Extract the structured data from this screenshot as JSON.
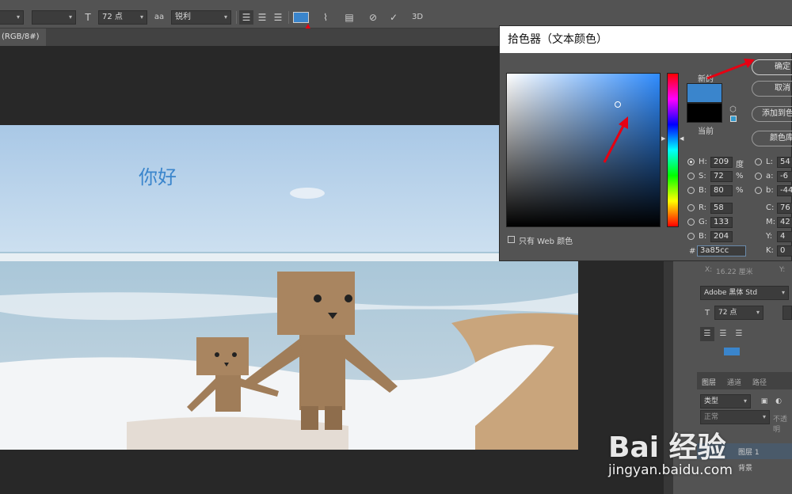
{
  "document": {
    "tab_label": "(RGB/8#)",
    "tab_close": "×"
  },
  "toolbar": {
    "font_size": "72 点",
    "aa_icon": "a",
    "aa_label": "aa",
    "antialias": "锐利",
    "threeD": "3D",
    "text_color": "#3a85cc"
  },
  "canvas": {
    "text_layer": "你好"
  },
  "dialog": {
    "title": "拾色器（文本颜色）",
    "new_label": "新的",
    "current_label": "当前",
    "new_color": "#3a85cc",
    "current_color": "#000000",
    "buttons": {
      "ok": "确定",
      "cancel": "取消",
      "add_swatch": "添加到色",
      "color_library": "颜色库"
    },
    "web_only": "只有 Web 颜色",
    "fields": {
      "H": "209",
      "H_unit": "度",
      "S": "72",
      "S_unit": "%",
      "B": "80",
      "B_unit": "%",
      "R": "58",
      "G": "133",
      "Bl": "204",
      "L": "54",
      "a": "-6",
      "b": "-44",
      "C": "76",
      "M": "42",
      "Y": "4",
      "K": "0",
      "hex": "3a85cc"
    },
    "field_labels": {
      "H": "H:",
      "S": "S:",
      "B": "B:",
      "R": "R:",
      "G": "G:",
      "Bl": "B:",
      "L": "L:",
      "a": "a:",
      "b": "b:",
      "C": "C:",
      "M": "M:",
      "Y": "Y:",
      "K": "K:",
      "hex": "#"
    }
  },
  "properties_panel": {
    "x_label": "X:",
    "x_value": "16.22 厘米",
    "y_label": "Y:",
    "font_family": "Adobe 黑体 Std",
    "font_size": "72 点",
    "swatch_color": "#3a85cc"
  },
  "layers_panel": {
    "tabs": [
      "图层",
      "通道",
      "路径"
    ],
    "filter_label": "类型",
    "blend_mode": "正常",
    "opacity_label": "不透明",
    "layers": [
      "图层 1",
      "背景"
    ]
  },
  "watermark": {
    "brand": "Bai  经验",
    "url": "jingyan.baidu.com"
  }
}
